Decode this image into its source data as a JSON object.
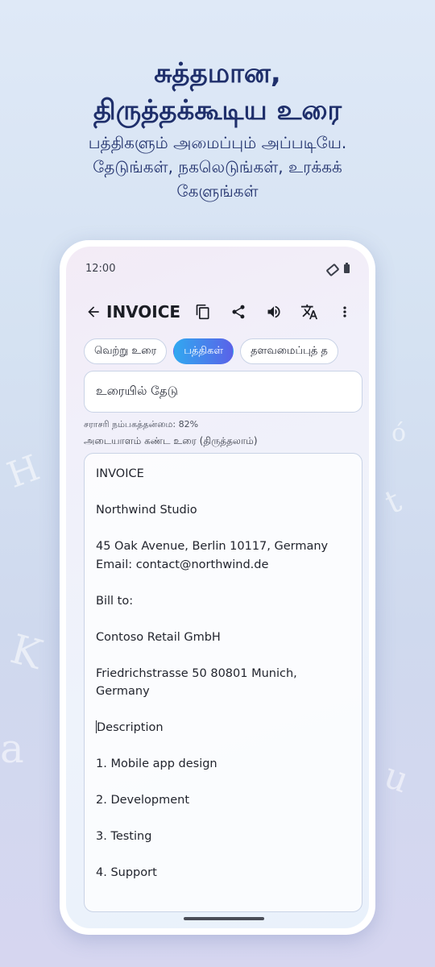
{
  "hero": {
    "title_line1": "சுத்தமான,",
    "title_line2": "திருத்தக்கூடிய உரை",
    "subtitle_line1": "பத்திகளும் அமைப்பும் அப்படியே.",
    "subtitle_line2": "தேடுங்கள், நகலெடுங்கள், உரக்கக்",
    "subtitle_line3": "கேளுங்கள்"
  },
  "status_bar": {
    "time": "12:00"
  },
  "app_bar": {
    "title": "INVOICE",
    "icons": [
      "back-arrow-icon",
      "copy-icon",
      "share-icon",
      "volume-icon",
      "translate-icon",
      "more-vert-icon"
    ]
  },
  "chips": [
    {
      "label": "வெற்று உரை",
      "active": false
    },
    {
      "label": "பத்திகள்",
      "active": true
    },
    {
      "label": "தளவமைப்புத் த",
      "active": false
    }
  ],
  "search": {
    "placeholder": "உரையில் தேடு"
  },
  "meta": {
    "confidence": "சராசரி நம்பகத்தன்மை: 82%",
    "recognized_label": "அடையாளம் கண்ட உரை (திருத்தலாம்)"
  },
  "document": {
    "p1": "INVOICE",
    "p2": "Northwind Studio",
    "p3_l1": "45 Oak Avenue, Berlin 10117, Germany",
    "p3_l2": "Email: contact@northwind.de",
    "p4": "Bill to:",
    "p5": "Contoso Retail GmbH",
    "p6_l1": "Friedrichstrasse 50 80801 Munich,",
    "p6_l2": "Germany",
    "p7": "Description",
    "p8": "1. Mobile app design",
    "p9": "2. Development",
    "p10": "3. Testing",
    "p11": "4. Support"
  },
  "colors": {
    "title_color": "#1f2f6b",
    "chip_active_start": "#31a8f0",
    "chip_active_end": "#5a62e8"
  }
}
